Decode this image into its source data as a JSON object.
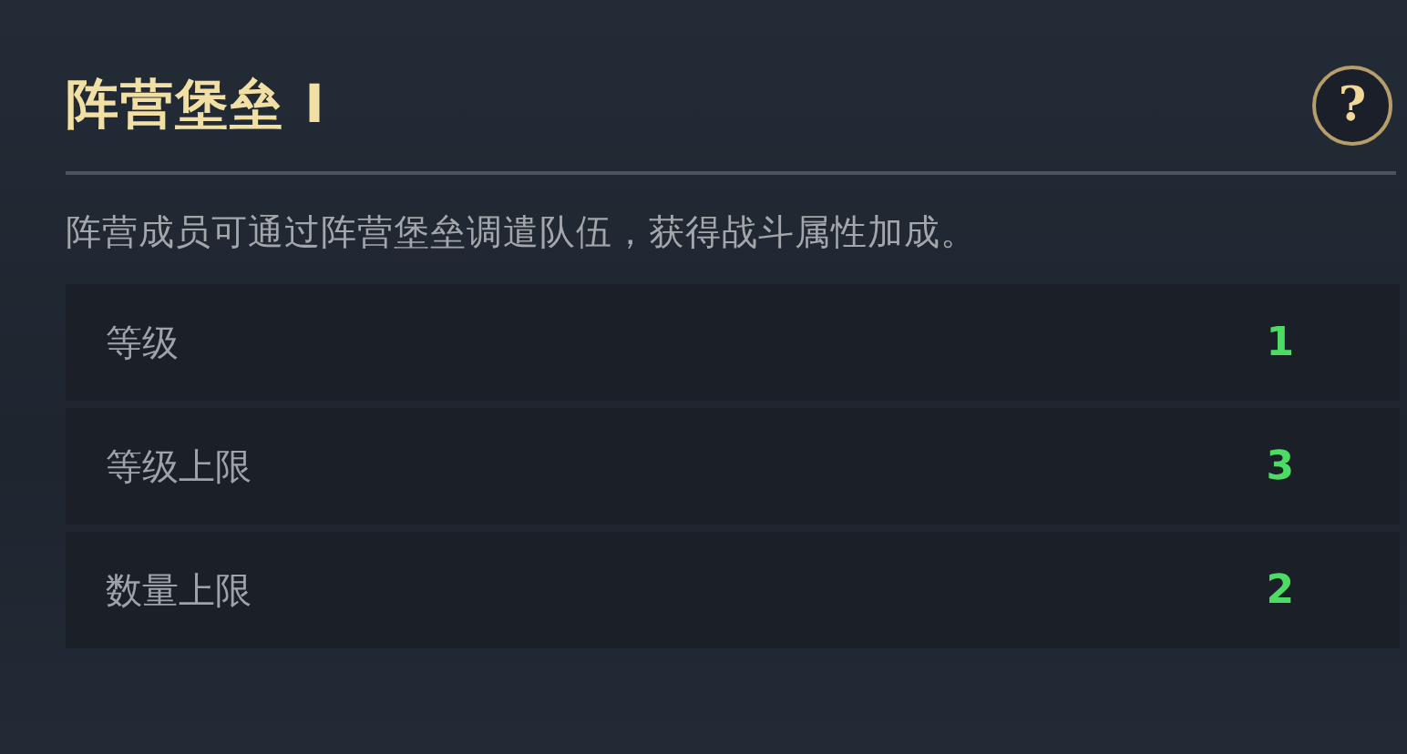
{
  "title": "阵营堡垒 I",
  "help_button": "?",
  "description": "阵营成员可通过阵营堡垒调遣队伍，获得战斗属性加成。",
  "stats": [
    {
      "label": "等级",
      "value": "1"
    },
    {
      "label": "等级上限",
      "value": "3"
    },
    {
      "label": "数量上限",
      "value": "2"
    }
  ]
}
